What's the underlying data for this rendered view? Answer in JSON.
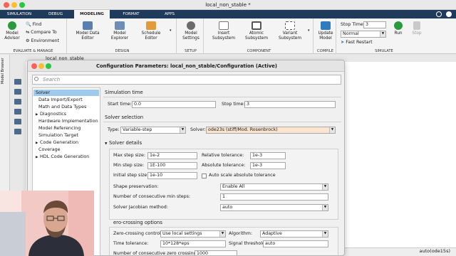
{
  "window": {
    "title": "local_non_stable *"
  },
  "tabs": [
    {
      "label": "SIMULATION"
    },
    {
      "label": "DEBUG"
    },
    {
      "label": "MODELING"
    },
    {
      "label": "FORMAT"
    },
    {
      "label": "APPS"
    }
  ],
  "ribbon": {
    "evaluate": {
      "label": "EVALUATE & MANAGE",
      "model_advisor": "Model Advisor",
      "find": "Find",
      "compare": "Compare To",
      "environment": "Environment"
    },
    "design": {
      "label": "DESIGN",
      "model_data_editor": "Model Data Editor",
      "model_explorer": "Model Explorer",
      "schedule_editor": "Schedule Editor"
    },
    "setup": {
      "label": "SETUP",
      "model_settings": "Model Settings"
    },
    "component": {
      "label": "COMPONENT",
      "insert_subsystem": "Insert Subsystem",
      "atomic_subsystem": "Atomic Subsystem",
      "variant_subsystem": "Variant Subsystem"
    },
    "compile": {
      "label": "COMPILE",
      "update_model": "Update Model"
    },
    "simulate": {
      "label": "SIMULATE",
      "stop_time_label": "Stop Time",
      "stop_time_value": "3",
      "mode": "Normal",
      "fast_restart": "Fast Restart",
      "run": "Run",
      "stop": "Stop"
    }
  },
  "canvas": {
    "model_tab": "local_non_stable",
    "model_browser": "Model Browser",
    "status_solver": "auto(ode15s)"
  },
  "dialog": {
    "title": "Configuration Parameters: local_non_stable/Configuration (Active)",
    "search_placeholder": "Search",
    "tree": [
      {
        "label": "Solver",
        "expand": false
      },
      {
        "label": "Data Import/Export",
        "expand": false
      },
      {
        "label": "Math and Data Types",
        "expand": false
      },
      {
        "label": "Diagnostics",
        "expand": true
      },
      {
        "label": "Hardware Implementation",
        "expand": false
      },
      {
        "label": "Model Referencing",
        "expand": false
      },
      {
        "label": "Simulation Target",
        "expand": false
      },
      {
        "label": "Code Generation",
        "expand": true
      },
      {
        "label": "Coverage",
        "expand": false
      },
      {
        "label": "HDL Code Generation",
        "expand": true
      }
    ],
    "simulation_time": {
      "heading": "Simulation time",
      "start_label": "Start time:",
      "start_value": "0.0",
      "stop_label": "Stop time:",
      "stop_value": "3"
    },
    "solver_selection": {
      "heading": "Solver selection",
      "type_label": "Type:",
      "type_value": "Variable-step",
      "solver_label": "Solver:",
      "solver_value": "ode23s (stiff/Mod. Rosenbrock)"
    },
    "solver_details": {
      "heading": "Solver details",
      "max_step_label": "Max step size:",
      "max_step_value": "1e-2",
      "rel_tol_label": "Relative tolerance:",
      "rel_tol_value": "1e-3",
      "min_step_label": "Min step size:",
      "min_step_value": "1E-100",
      "abs_tol_label": "Absolute tolerance:",
      "abs_tol_value": "1e-3",
      "init_step_label": "Initial step size:",
      "init_step_value": "1e-10",
      "auto_scale_label": "Auto scale absolute tolerance",
      "shape_label": "Shape preservation:",
      "shape_value": "Enable All",
      "consec_min_label": "Number of consecutive min steps:",
      "consec_min_value": "1",
      "jacobian_label": "Solver Jacobian method:",
      "jacobian_value": "auto"
    },
    "zero_crossing": {
      "heading": "ero-crossing options",
      "control_label": "Zero-crossing control:",
      "control_value": "Use local settings",
      "algorithm_label": "Algorithm:",
      "algorithm_value": "Adaptive",
      "time_tol_label": "Time tolerance:",
      "time_tol_value": "10*128*eps",
      "signal_thr_label": "Signal threshold:",
      "signal_thr_value": "auto",
      "consec_zc_label": "Number of consecutive zero crossings:",
      "consec_zc_value": "1000"
    }
  }
}
